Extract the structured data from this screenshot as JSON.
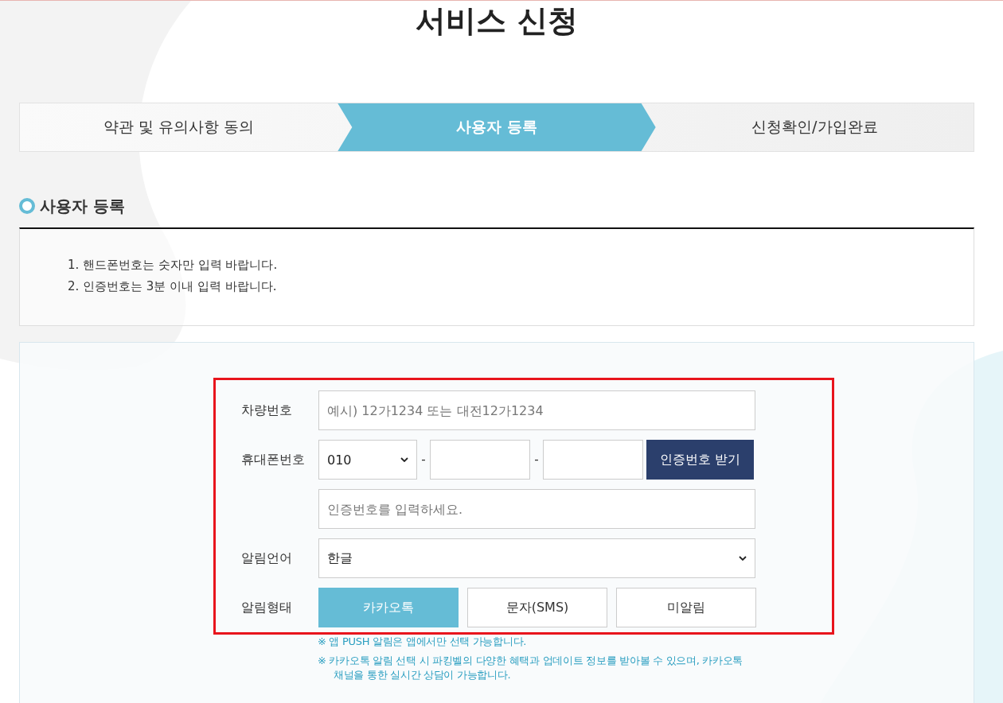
{
  "page_title": "서비스 신청",
  "steps": [
    {
      "label": "약관 및 유의사항 동의",
      "selected": false
    },
    {
      "label": "사용자 등록",
      "selected": true
    },
    {
      "label": "신청확인/가입완료",
      "selected": false
    }
  ],
  "section_title": "사용자 등록",
  "notices": [
    "1. 핸드폰번호는 숫자만 입력 바랍니다.",
    "2. 인증번호는 3분 이내 입력 바랍니다."
  ],
  "form": {
    "highlighted": true,
    "vehicle": {
      "label": "차량번호",
      "placeholder": "예시) 12가1234 또는 대전12가1234"
    },
    "phone": {
      "label": "휴대폰번호",
      "prefix": "010",
      "separator_1": "-",
      "separator_2": "-",
      "button": "인증번호 받기",
      "code_placeholder": "인증번호를 입력하세요."
    },
    "language": {
      "label": "알림언어",
      "value": "한글"
    },
    "notify_type": {
      "label": "알림형태",
      "options": [
        {
          "label": "카카오톡",
          "selected": true
        },
        {
          "label": "문자(SMS)",
          "selected": false
        },
        {
          "label": "미알림",
          "selected": false
        }
      ]
    },
    "notes": [
      "※ 앱 PUSH 알림은 앱에서만 선택 가능합니다.",
      "※ 카카오톡 알림 선택 시 파킹벨의 다양한 혜택과 업데이트 정보를 받아볼 수 있으며, 카카오톡 채널을 통한 실시간 상담이 가능합니다."
    ]
  }
}
